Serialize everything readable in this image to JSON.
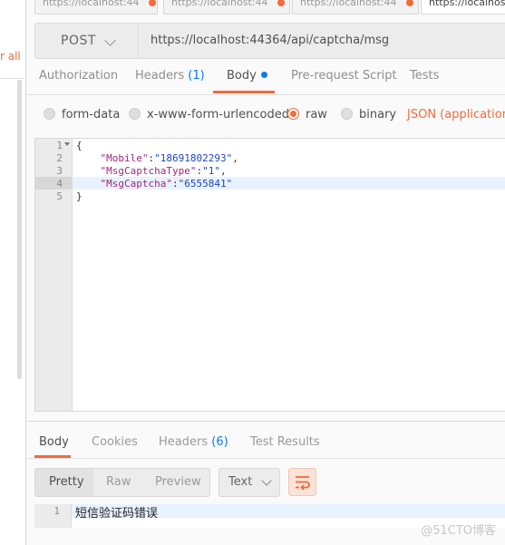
{
  "sidebar": {
    "view_all_label": "r all"
  },
  "tabs": [
    {
      "label": "https://localhost:44",
      "dirty": true
    },
    {
      "label": "https://localhost:44",
      "dirty": true
    },
    {
      "label": "https://localhost:44",
      "dirty": true
    },
    {
      "label": "https://localhost:44",
      "dirty": false
    }
  ],
  "request": {
    "method": "POST",
    "url": "https://localhost:44364/api/captcha/msg"
  },
  "request_tabs": {
    "authorization": "Authorization",
    "headers": "Headers",
    "headers_count": "(1)",
    "body": "Body",
    "pre_request": "Pre-request Script",
    "tests": "Tests"
  },
  "body_modes": {
    "form_data": "form-data",
    "urlencoded": "x-www-form-urlencoded",
    "raw": "raw",
    "binary": "binary",
    "selected": "raw",
    "content_type": "JSON (application/js"
  },
  "editor": {
    "line_numbers": [
      "1",
      "2",
      "3",
      "4",
      "5"
    ],
    "lines": {
      "open": "{",
      "mobile_key": "\"Mobile\"",
      "mobile_val": "\"18691802293\"",
      "type_key": "\"MsgCaptchaType\"",
      "type_val": "\"1\"",
      "captcha_key": "\"MsgCaptcha\"",
      "captcha_val": "\"6555841\"",
      "close": "}"
    },
    "active_line": 4
  },
  "response_tabs": {
    "body": "Body",
    "cookies": "Cookies",
    "headers": "Headers",
    "headers_count": "(6)",
    "test_results": "Test Results"
  },
  "response_view": {
    "pretty": "Pretty",
    "raw": "Raw",
    "preview": "Preview",
    "format": "Text"
  },
  "response_body": {
    "line_number": "1",
    "text": "短信验证码错误"
  },
  "watermark": "@51CTO博客",
  "colors": {
    "accent": "#f26b3a",
    "link": "#097bed",
    "json_key": "#a3267e",
    "json_string": "#1f45c2"
  }
}
